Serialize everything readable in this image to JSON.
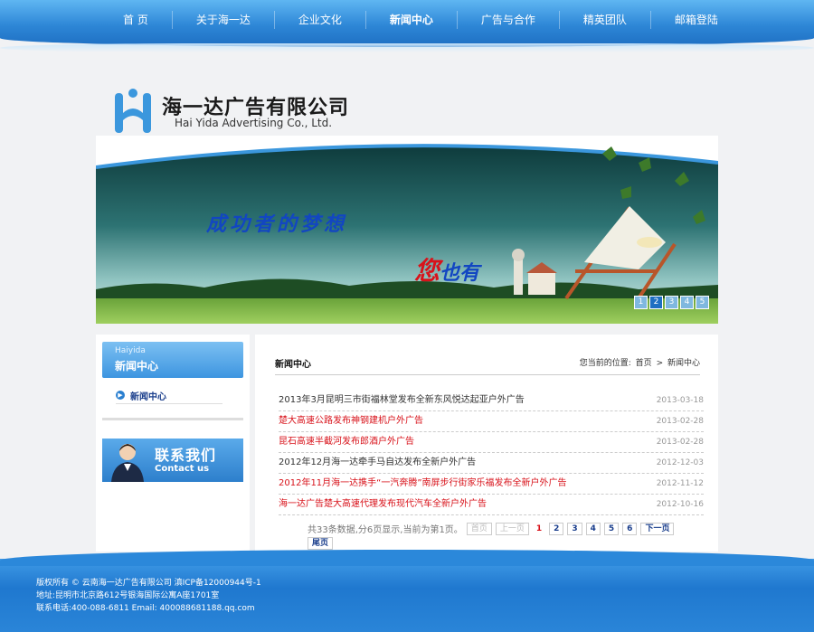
{
  "nav": {
    "items": [
      {
        "label": "首 页"
      },
      {
        "label": "关于海一达"
      },
      {
        "label": "企业文化"
      },
      {
        "label": "新闻中心",
        "active": true
      },
      {
        "label": "广告与合作"
      },
      {
        "label": "精英团队"
      },
      {
        "label": "邮箱登陆"
      }
    ]
  },
  "logo": {
    "cn": "海一达广告有限公司",
    "en": "Hai Yida Advertising Co., Ltd."
  },
  "banner": {
    "slogan_line1": "成功者的梦想",
    "slogan_red": "您",
    "slogan_blue": "也有",
    "slides": [
      "1",
      "2",
      "3",
      "4",
      "5"
    ],
    "active_slide": 2
  },
  "sidebar": {
    "header_en": "Haiyida",
    "header_cn": "新闻中心",
    "items": [
      {
        "label": "新闻中心"
      }
    ],
    "contact_cn": "联系我们",
    "contact_en": "Contact us"
  },
  "main": {
    "title": "新闻中心",
    "breadcrumb_prefix": "您当前的位置:",
    "breadcrumb_home": "首页",
    "breadcrumb_sep": ">",
    "breadcrumb_current": "新闻中心",
    "news": [
      {
        "title": "2013年3月昆明三市街福林堂发布全新东风悦达起亚户外广告",
        "date": "2013-03-18",
        "red": false
      },
      {
        "title": "楚大高速公路发布神钢建机户外广告",
        "date": "2013-02-28",
        "red": true
      },
      {
        "title": "昆石高速半截河发布郎酒户外广告",
        "date": "2013-02-28",
        "red": true
      },
      {
        "title": "2012年12月海一达牵手马自达发布全新户外广告",
        "date": "2012-12-03",
        "red": false
      },
      {
        "title": "2012年11月海一达携手“一汽奔腾”南屏步行街家乐福发布全新户外广告",
        "date": "2012-11-12",
        "red": true
      },
      {
        "title": "海一达广告楚大高速代理发布现代汽车全新户外广告",
        "date": "2012-10-16",
        "red": true
      }
    ],
    "pager": {
      "summary": "共33条数据,分6页显示,当前为第1页。",
      "first": "首页",
      "prev": "上一页",
      "pages": [
        "1",
        "2",
        "3",
        "4",
        "5",
        "6"
      ],
      "current": "1",
      "next": "下一页",
      "last": "尾页"
    }
  },
  "footer": {
    "line1": "版权所有 © 云南海一达广告有限公司  滇ICP备12000944号-1",
    "line2": "地址:昆明市北京路612号银海国际公寓A座1701室",
    "line3": "联系电话:400-088-6811 Email: 400088681188.qq.com"
  },
  "colors": {
    "brand_blue": "#2d86d6",
    "news_red": "#d8121a",
    "link_blue": "#1a3e8c"
  }
}
